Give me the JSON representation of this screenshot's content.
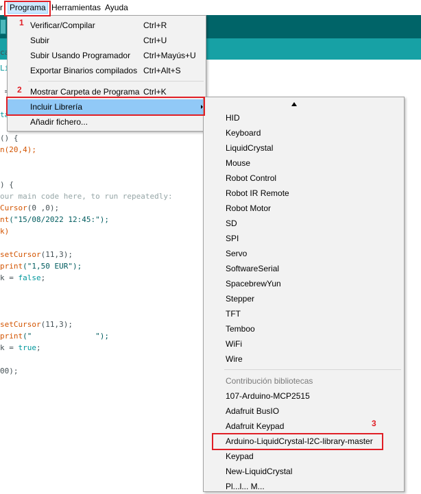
{
  "menubar": {
    "items": [
      "r",
      "Programa",
      "Herramientas",
      "Ayuda"
    ]
  },
  "menu": {
    "items": [
      {
        "label": "Verificar/Compilar",
        "shortcut": "Ctrl+R"
      },
      {
        "label": "Subir",
        "shortcut": "Ctrl+U"
      },
      {
        "label": "Subir Usando Programador",
        "shortcut": "Ctrl+Mayús+U"
      },
      {
        "label": "Exportar Binarios compilados",
        "shortcut": "Ctrl+Alt+S"
      },
      {
        "label": "Mostrar Carpeta de Programa",
        "shortcut": "Ctrl+K"
      },
      {
        "label": "Incluir Librería",
        "shortcut": ""
      },
      {
        "label": "Añadir fichero...",
        "shortcut": ""
      }
    ]
  },
  "submenu": {
    "libraries": [
      "HID",
      "Keyboard",
      "LiquidCrystal",
      "Mouse",
      "Robot Control",
      "Robot IR Remote",
      "Robot Motor",
      "SD",
      "SPI",
      "Servo",
      "SoftwareSerial",
      "SpacebrewYun",
      "Stepper",
      "TFT",
      "Temboo",
      "WiFi",
      "Wire"
    ],
    "contrib_header": "Contribución bibliotecas",
    "contrib": [
      "107-Arduino-MCP2515",
      "Adafruit BusIO",
      "Adafruit Keypad",
      "Arduino-LiquidCrystal-I2C-library-master",
      "Keypad",
      "New-LiquidCrystal",
      "Pl...l... M..."
    ]
  },
  "annotations": [
    "1",
    "2",
    "3"
  ],
  "code": {
    "l1": "ca",
    "l2": "Li",
    "l3": " =",
    "l4": "ta",
    "l5a": "() {",
    "l6a": "n(20,4);",
    "l7a": ") {",
    "l8a": "our main code here, to run repeatedly:",
    "l9a": "Cursor",
    "l9b": "(0 ,0);",
    "l10a": "nt",
    "l10b": "(\"15/08/2022 12:45:\");",
    "l11a": "k)",
    "l12a": "setCursor",
    "l12b": "(11,3);",
    "l13a": "print",
    "l13b": "(\"1,50 EUR\");",
    "l14a": "k = ",
    "l14b": "false",
    "l14c": ";",
    "l15a": "setCursor",
    "l15b": "(11,3);",
    "l16a": "print",
    "l16b": "(\"              \");",
    "l17a": "k = ",
    "l17b": "true",
    "l17c": ";",
    "l18a": "00);"
  },
  "colors": {
    "toolbar": "#006468",
    "tabbar": "#17a1a5",
    "highlight": "#91c9f7",
    "annotation": "#e01e25"
  }
}
